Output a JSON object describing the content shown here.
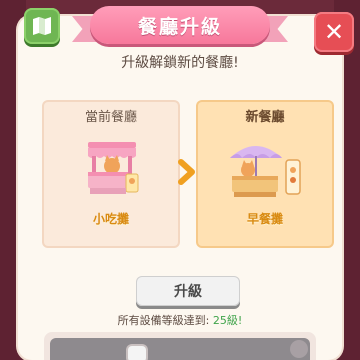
{
  "header": {
    "title": "餐廳升級",
    "close_glyph": "✕",
    "map_icon": "map-icon"
  },
  "subtitle": "升級解鎖新的餐廳!",
  "current": {
    "label": "當前餐廳",
    "name": "小吃攤"
  },
  "next": {
    "label": "新餐廳",
    "name": "早餐攤"
  },
  "upgrade_button": "升級",
  "requirement": {
    "text": "所有設備等級達到:",
    "value": "25級!"
  },
  "colors": {
    "banner": "#f7789b",
    "close": "#e64e55",
    "map": "#6fb653",
    "accent_name": "#d98a12",
    "requirement_ok": "#3fa34a"
  }
}
